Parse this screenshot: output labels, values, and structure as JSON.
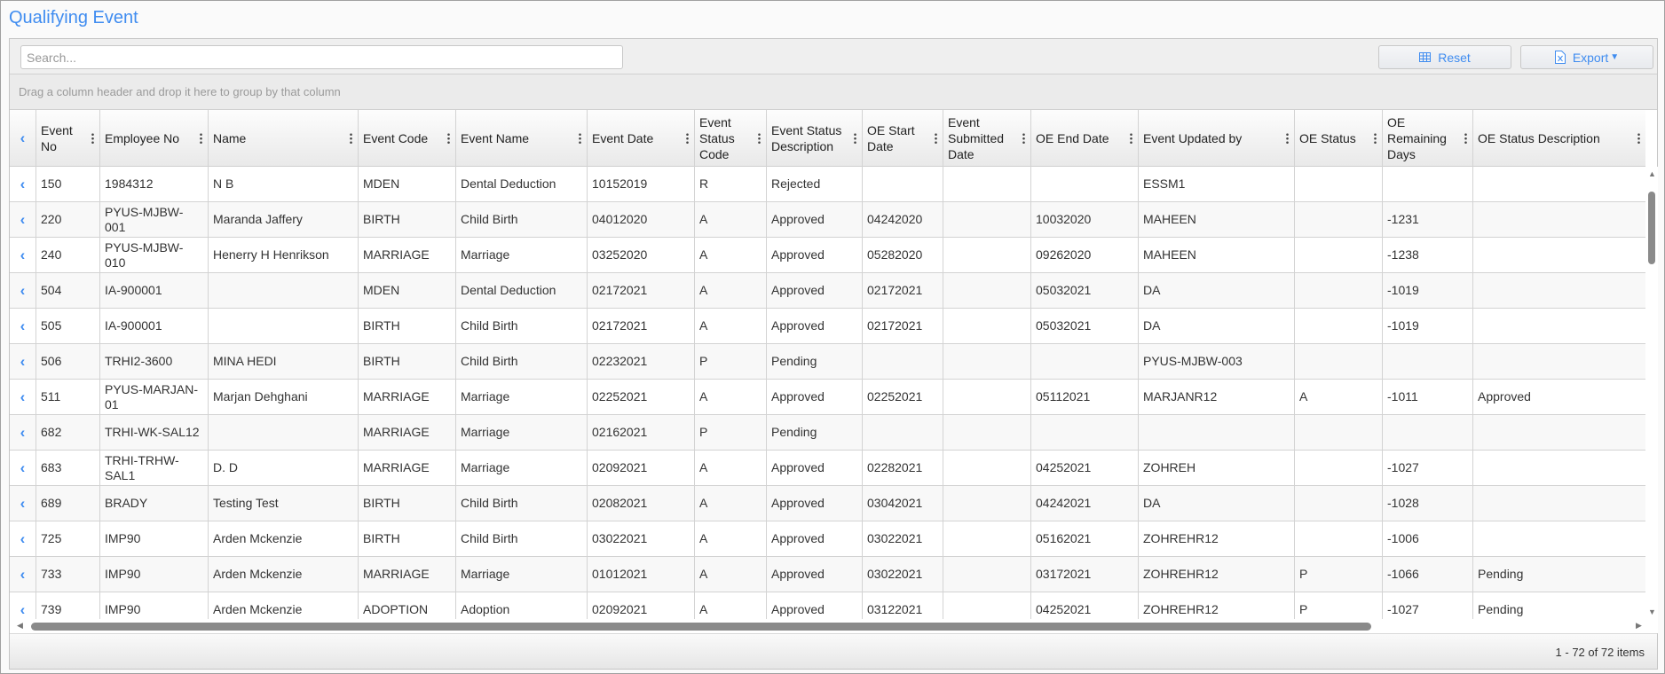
{
  "title": "Qualifying Event",
  "toolbar": {
    "search_placeholder": "Search...",
    "reset_label": "Reset",
    "export_label": "Export",
    "reset_icon": "grid-icon",
    "export_icon": "excel-file-icon"
  },
  "group_hint": "Drag a column header and drop it here to group by that column",
  "columns": [
    "Event No",
    "Employee No",
    "Name",
    "Event Code",
    "Event Name",
    "Event Date",
    "Event Status Code",
    "Event Status Description",
    "OE Start Date",
    "Event Submitted Date",
    "OE End Date",
    "Event Updated by",
    "OE Status",
    "OE Remaining Days",
    "OE Status Description"
  ],
  "rows": [
    [
      "150",
      "1984312",
      "N B",
      "MDEN",
      "Dental Deduction",
      "10152019",
      "R",
      "Rejected",
      "",
      "",
      "",
      "ESSM1",
      "",
      "",
      ""
    ],
    [
      "220",
      "PYUS-MJBW-001",
      "Maranda Jaffery",
      "BIRTH",
      "Child Birth",
      "04012020",
      "A",
      "Approved",
      "04242020",
      "",
      "10032020",
      "MAHEEN",
      "",
      "-1231",
      ""
    ],
    [
      "240",
      "PYUS-MJBW-010",
      "Henerry H Henrikson",
      "MARRIAGE",
      "Marriage",
      "03252020",
      "A",
      "Approved",
      "05282020",
      "",
      "09262020",
      "MAHEEN",
      "",
      "-1238",
      ""
    ],
    [
      "504",
      "IA-900001",
      "",
      "MDEN",
      "Dental Deduction",
      "02172021",
      "A",
      "Approved",
      "02172021",
      "",
      "05032021",
      "DA",
      "",
      "-1019",
      ""
    ],
    [
      "505",
      "IA-900001",
      "",
      "BIRTH",
      "Child Birth",
      "02172021",
      "A",
      "Approved",
      "02172021",
      "",
      "05032021",
      "DA",
      "",
      "-1019",
      ""
    ],
    [
      "506",
      "TRHI2-3600",
      "MINA HEDI",
      "BIRTH",
      "Child Birth",
      "02232021",
      "P",
      "Pending",
      "",
      "",
      "",
      "PYUS-MJBW-003",
      "",
      "",
      ""
    ],
    [
      "511",
      "PYUS-MARJAN-01",
      "Marjan Dehghani",
      "MARRIAGE",
      "Marriage",
      "02252021",
      "A",
      "Approved",
      "02252021",
      "",
      "05112021",
      "MARJANR12",
      "A",
      "-1011",
      "Approved"
    ],
    [
      "682",
      "TRHI-WK-SAL12",
      "",
      "MARRIAGE",
      "Marriage",
      "02162021",
      "P",
      "Pending",
      "",
      "",
      "",
      "",
      "",
      "",
      ""
    ],
    [
      "683",
      "TRHI-TRHW-SAL1",
      "D. D",
      "MARRIAGE",
      "Marriage",
      "02092021",
      "A",
      "Approved",
      "02282021",
      "",
      "04252021",
      "ZOHREH",
      "",
      "-1027",
      ""
    ],
    [
      "689",
      "BRADY",
      "Testing Test",
      "BIRTH",
      "Child Birth",
      "02082021",
      "A",
      "Approved",
      "03042021",
      "",
      "04242021",
      "DA",
      "",
      "-1028",
      ""
    ],
    [
      "725",
      "IMP90",
      "Arden Mckenzie",
      "BIRTH",
      "Child Birth",
      "03022021",
      "A",
      "Approved",
      "03022021",
      "",
      "05162021",
      "ZOHREHR12",
      "",
      "-1006",
      ""
    ],
    [
      "733",
      "IMP90",
      "Arden Mckenzie",
      "MARRIAGE",
      "Marriage",
      "01012021",
      "A",
      "Approved",
      "03022021",
      "",
      "03172021",
      "ZOHREHR12",
      "P",
      "-1066",
      "Pending"
    ],
    [
      "739",
      "IMP90",
      "Arden Mckenzie",
      "ADOPTION",
      "Adoption",
      "02092021",
      "A",
      "Approved",
      "03122021",
      "",
      "04252021",
      "ZOHREHR12",
      "P",
      "-1027",
      "Pending"
    ]
  ],
  "pager": "1 - 72 of 72 items",
  "colors": {
    "accent": "#3f8cf0"
  }
}
